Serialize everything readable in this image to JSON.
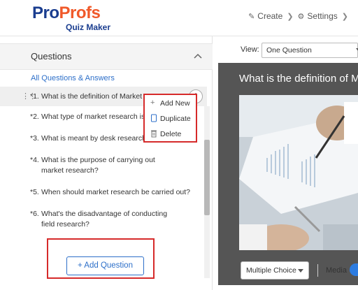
{
  "header": {
    "logo_part1": "Pro",
    "logo_part2": "Profs",
    "logo_sub": "Quiz Maker",
    "nav": [
      {
        "label": "Create",
        "icon": "pencil-icon"
      },
      {
        "label": "Settings",
        "icon": "gear-icon"
      }
    ]
  },
  "sidebar": {
    "title": "Questions",
    "all_link": "All Questions & Answers",
    "questions": [
      {
        "num": "*1.",
        "text": "What is the definition of Market Re"
      },
      {
        "num": "*2.",
        "text": "What type of market research is a"
      },
      {
        "num": "*3.",
        "text": "What is meant by desk research?"
      },
      {
        "num": "*4.",
        "text": "What is the purpose of carrying out market research?"
      },
      {
        "num": "*5.",
        "text": "When should market research be carried out?"
      },
      {
        "num": "*6.",
        "text": "What's the disadvantage of conducting field research?"
      }
    ],
    "add_button": "+ Add Question"
  },
  "context_menu": {
    "items": [
      {
        "label": "Add New",
        "icon": "plus-icon"
      },
      {
        "label": "Duplicate",
        "icon": "copy-icon"
      },
      {
        "label": "Delete",
        "icon": "trash-icon"
      }
    ]
  },
  "main": {
    "view_label": "View:",
    "view_value": "One Question",
    "question_title": "What is the definition of M",
    "question_type": "Multiple Choice",
    "media_label": "Media"
  },
  "colors": {
    "brand_blue": "#1a3d8f",
    "brand_orange": "#f0592a",
    "link_blue": "#2d6fc9",
    "highlight_red": "#d62a2a"
  }
}
